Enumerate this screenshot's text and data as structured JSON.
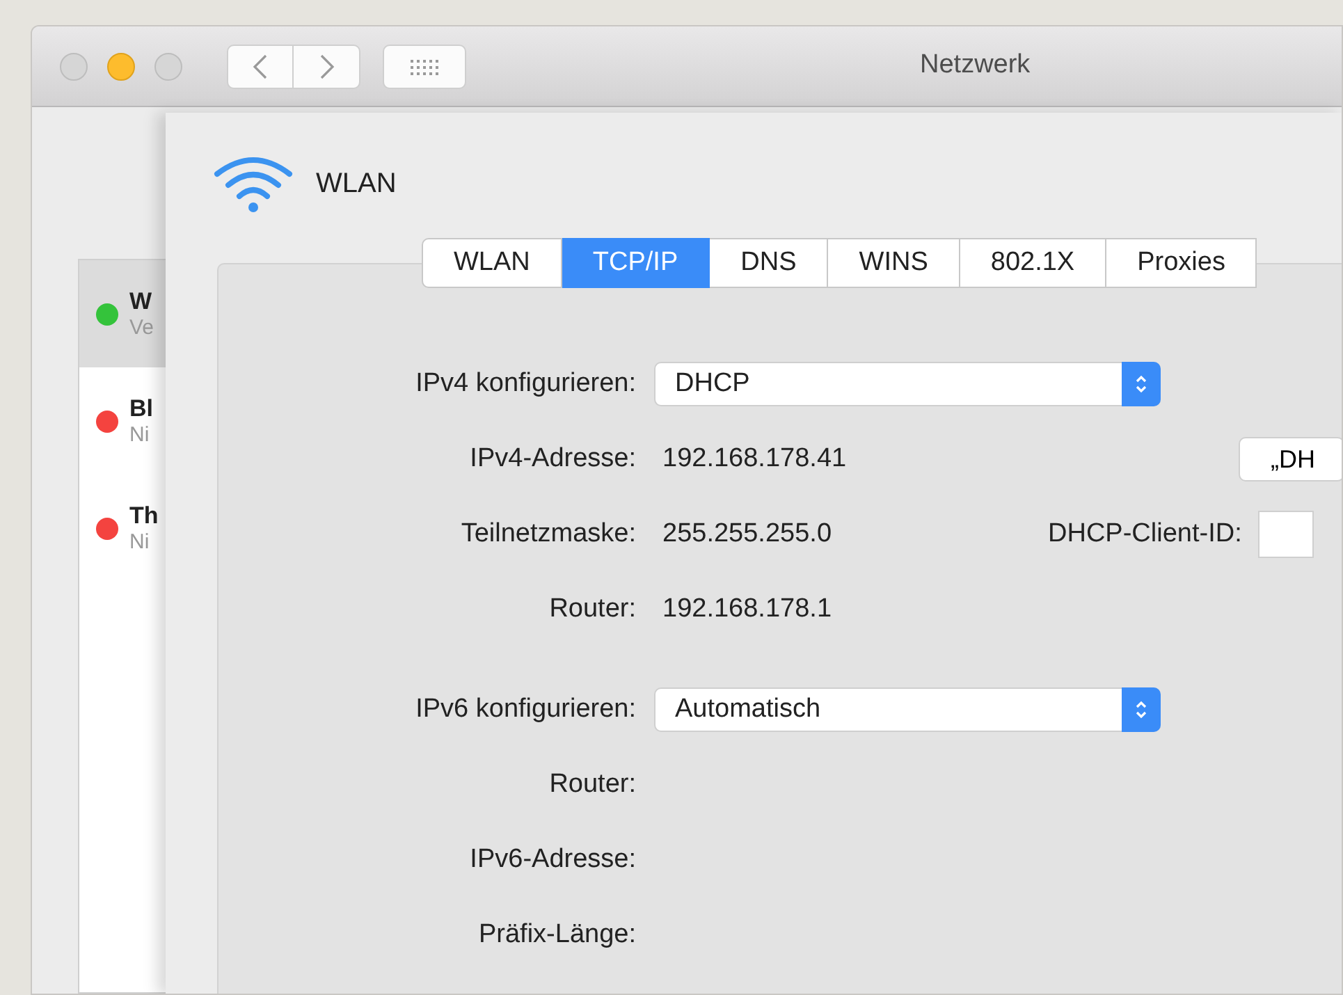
{
  "window": {
    "title": "Netzwerk"
  },
  "sidebar": {
    "items": [
      {
        "name": "W",
        "status": "Ve",
        "color": "#34c33b",
        "selected": true
      },
      {
        "name": "Bl",
        "status": "Ni",
        "color": "#f4433f",
        "selected": false
      },
      {
        "name": "Th",
        "status": "Ni",
        "color": "#f4433f",
        "selected": false
      }
    ]
  },
  "sheet": {
    "title": "WLAN",
    "tabs": [
      {
        "label": "WLAN",
        "selected": false
      },
      {
        "label": "TCP/IP",
        "selected": true
      },
      {
        "label": "DNS",
        "selected": false
      },
      {
        "label": "WINS",
        "selected": false
      },
      {
        "label": "802.1X",
        "selected": false
      },
      {
        "label": "Proxies",
        "selected": false
      }
    ],
    "rows": [
      {
        "kind": "select",
        "label": "IPv4 konfigurieren:",
        "value": "DHCP"
      },
      {
        "kind": "text",
        "label": "IPv4-Adresse:",
        "value": "192.168.178.41",
        "extra": {
          "kind": "button",
          "label": "„DH"
        }
      },
      {
        "kind": "text",
        "label": "Teilnetzmaske:",
        "value": "255.255.255.0",
        "extra": {
          "kind": "field",
          "label": "DHCP-Client-ID:"
        }
      },
      {
        "kind": "text",
        "label": "Router:",
        "value": "192.168.178.1"
      },
      {
        "kind": "select",
        "label": "IPv6 konfigurieren:",
        "value": "Automatisch"
      },
      {
        "kind": "text",
        "label": "Router:"
      },
      {
        "kind": "text",
        "label": "IPv6-Adresse:"
      },
      {
        "kind": "text",
        "label": "Präfix-Länge:"
      }
    ]
  }
}
